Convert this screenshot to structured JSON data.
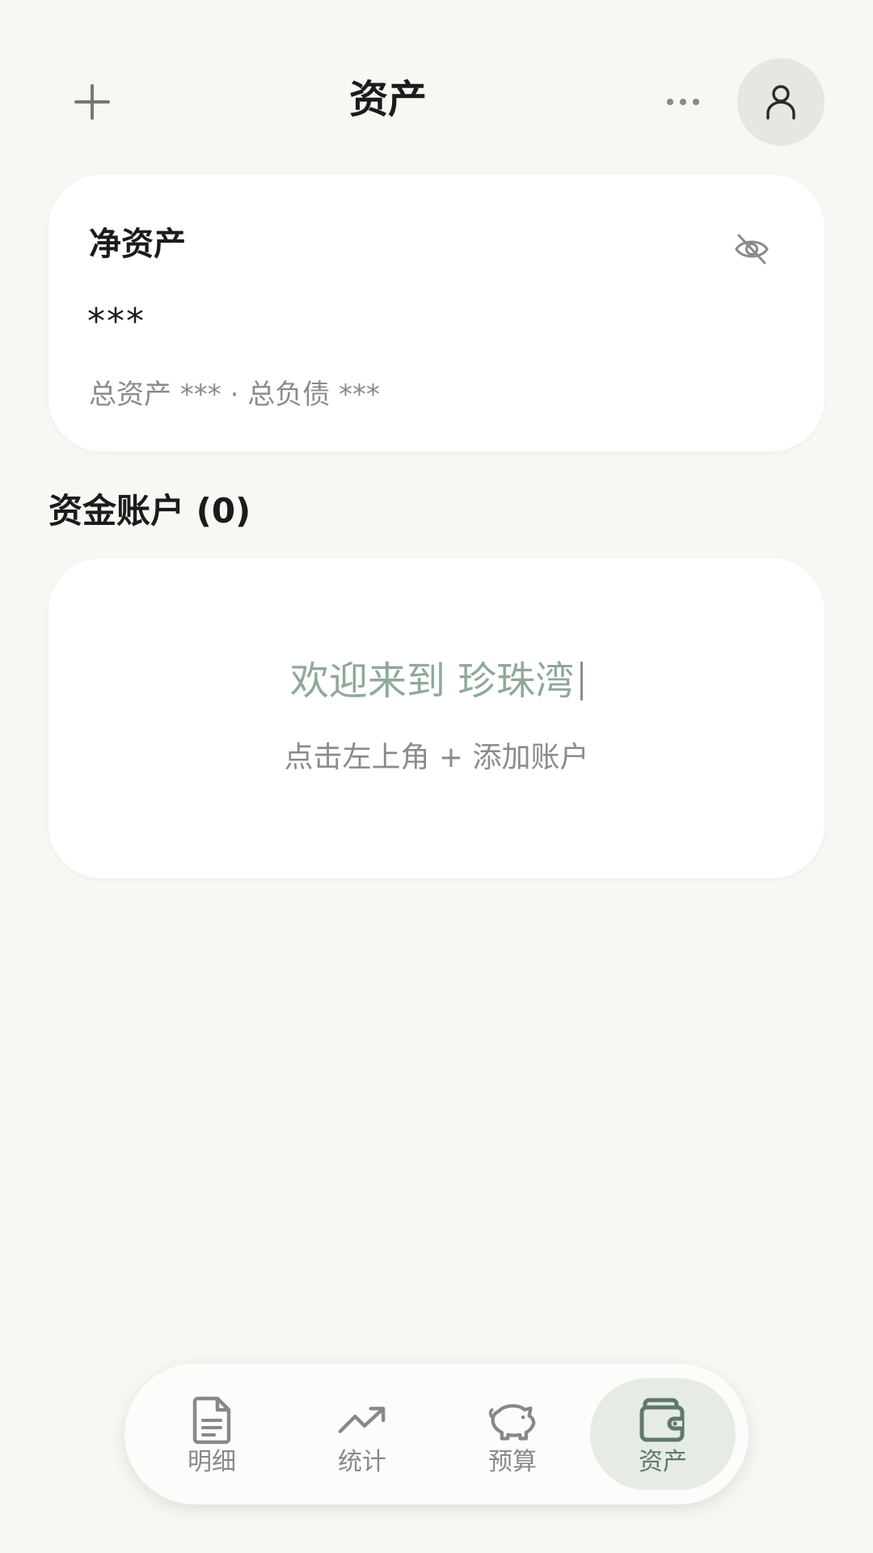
{
  "header": {
    "title": "资产",
    "add_icon": "plus-icon",
    "more_icon": "more-horizontal-icon",
    "profile_icon": "user-icon"
  },
  "net_assets_card": {
    "title": "净资产",
    "value": "***",
    "summary": "总资产 *** · 总负债 ***",
    "visibility_icon": "eye-off-icon"
  },
  "accounts": {
    "section_title": "资金账户 (0)",
    "empty_welcome": "欢迎来到 珍珠湾",
    "empty_hint": "点击左上角 + 添加账户"
  },
  "bottom_nav": {
    "items": [
      {
        "label": "明细",
        "icon": "document-icon",
        "active": false
      },
      {
        "label": "统计",
        "icon": "trend-up-icon",
        "active": false
      },
      {
        "label": "预算",
        "icon": "piggy-bank-icon",
        "active": false
      },
      {
        "label": "资产",
        "icon": "wallet-icon",
        "active": true
      }
    ]
  },
  "colors": {
    "background": "#f8f7f4",
    "card": "#ffffff",
    "accent_green": "#5e7a67",
    "welcome_green": "#8fa998",
    "muted_text": "#8b8b8b",
    "active_nav_bg": "#e6ebe6"
  }
}
